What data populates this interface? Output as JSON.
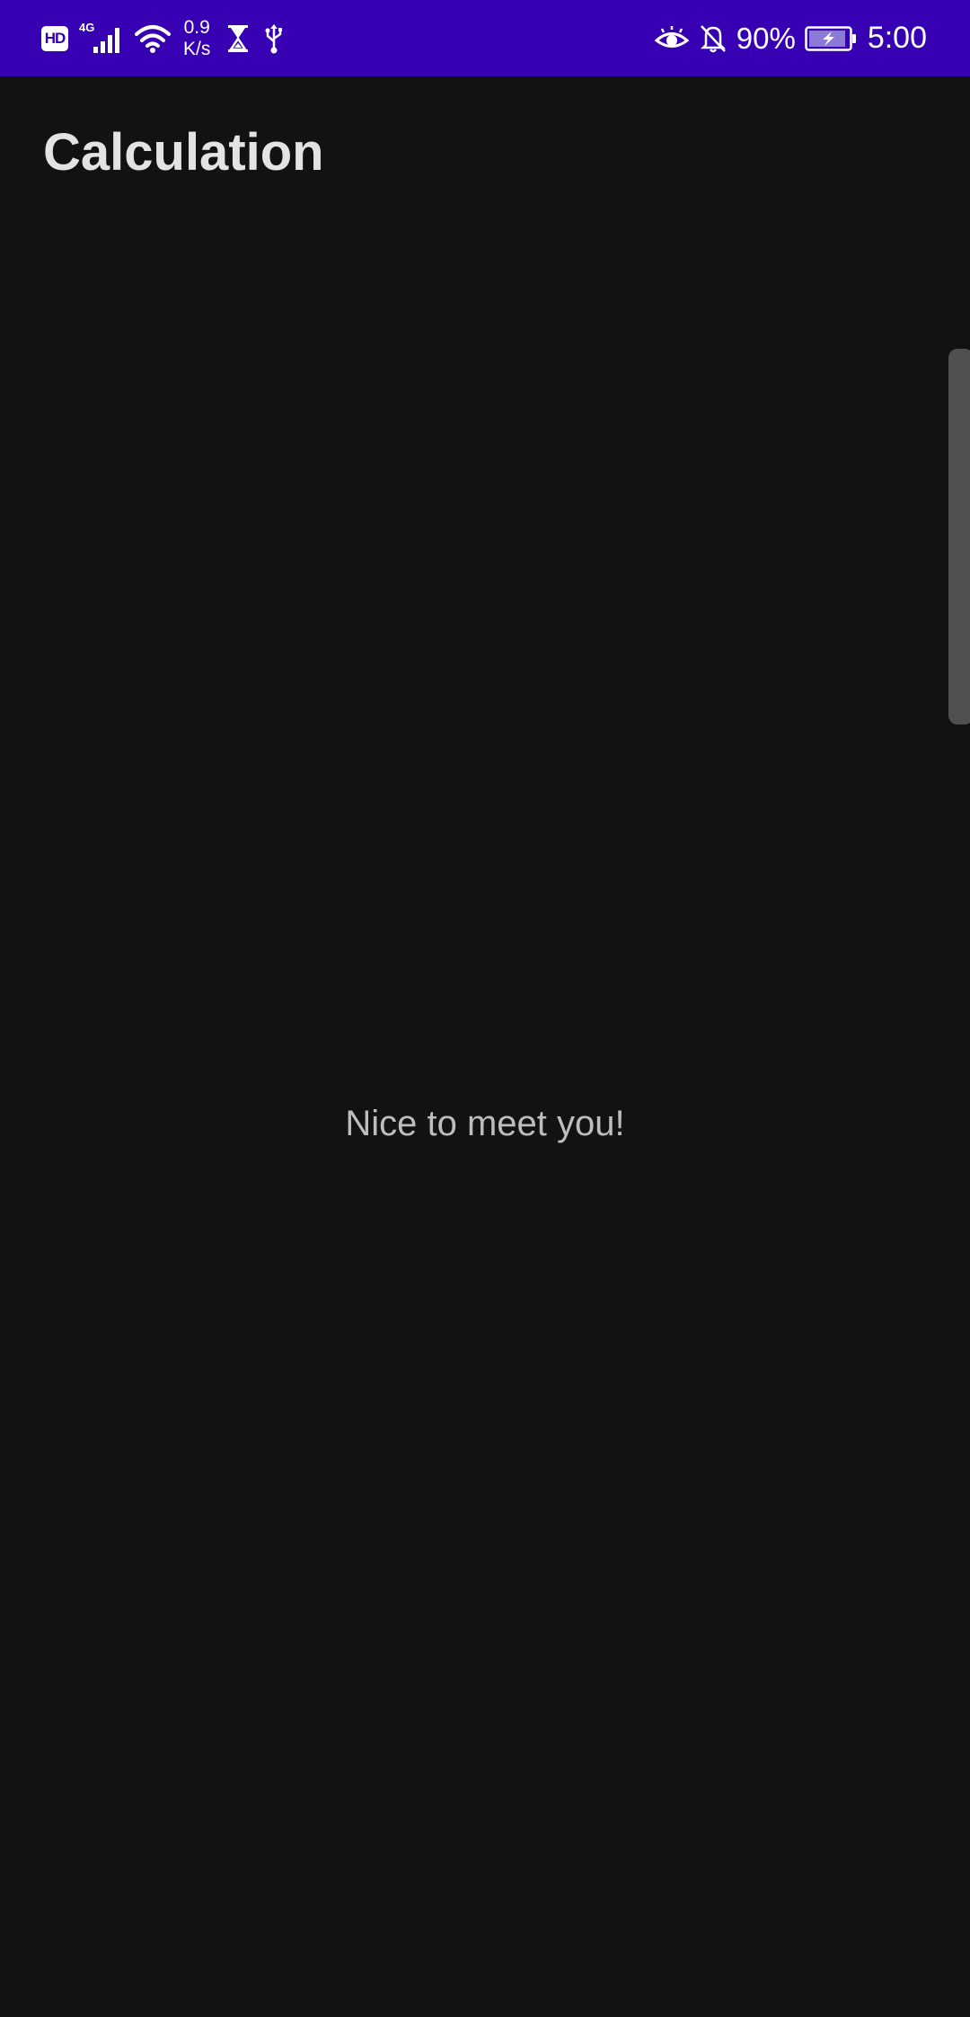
{
  "status_bar": {
    "hd_label": "HD",
    "network_gen": "4G",
    "speed_value": "0.9",
    "speed_unit": "K/s",
    "battery_percent": "90%",
    "time": "5:00",
    "icons": [
      "hd-icon",
      "signal-icon",
      "wifi-icon",
      "hourglass-icon",
      "usb-icon",
      "eye-icon",
      "bell-off-icon",
      "battery-charging-icon"
    ]
  },
  "app": {
    "title": "Calculation",
    "message": "Nice to meet you!"
  },
  "colors": {
    "status_bar": "#3700b3",
    "background": "#121212",
    "title_text": "#e3e3e3",
    "message_text": "#bdbdbd"
  }
}
